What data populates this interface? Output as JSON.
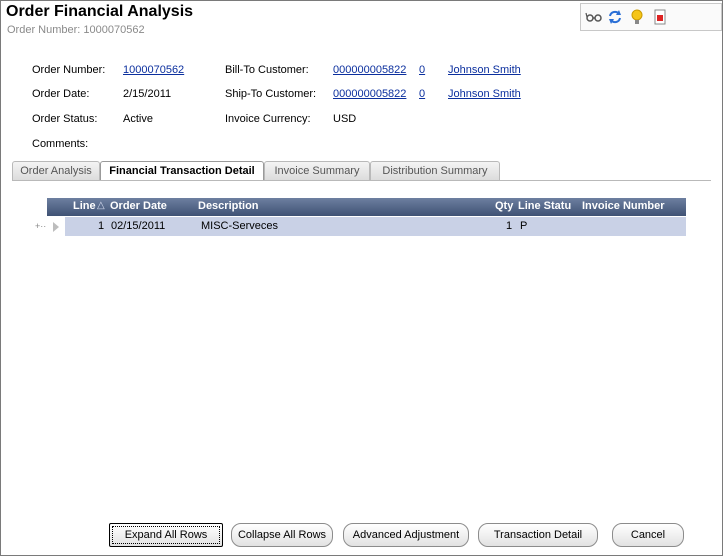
{
  "header": {
    "title": "Order Financial Analysis",
    "subtitle": "Order Number: 1000070562"
  },
  "toolbar_icons": [
    "glasses-icon",
    "refresh-icon",
    "lightbulb-icon",
    "pdf-icon"
  ],
  "fields": {
    "order_number_label": "Order Number:",
    "order_number_value": "1000070562",
    "order_date_label": "Order Date:",
    "order_date_value": "2/15/2011",
    "order_status_label": "Order Status:",
    "order_status_value": "Active",
    "comments_label": "Comments:",
    "bill_to_label": "Bill-To Customer:",
    "bill_to_id": "000000005822",
    "bill_to_sub": "0",
    "bill_to_name": "Johnson Smith",
    "ship_to_label": "Ship-To Customer:",
    "ship_to_id": "000000005822",
    "ship_to_sub": "0",
    "ship_to_name": "Johnson Smith",
    "invoice_currency_label": "Invoice Currency:",
    "invoice_currency_value": "USD"
  },
  "tabs": [
    {
      "label": "Order Analysis",
      "active": false
    },
    {
      "label": "Financial Transaction Detail",
      "active": true
    },
    {
      "label": "Invoice Summary",
      "active": false
    },
    {
      "label": "Distribution Summary",
      "active": false
    }
  ],
  "grid": {
    "columns": [
      "Line",
      "Order Date",
      "Description",
      "Qty",
      "Line Statu",
      "Invoice Number"
    ],
    "sort_indicator": "△",
    "row_control": "+··",
    "rows": [
      {
        "line": "1",
        "order_date": "02/15/2011",
        "description": "MISC-Serveces",
        "qty": "1",
        "line_status": "P",
        "invoice_number": ""
      }
    ]
  },
  "buttons": {
    "expand_all": "Expand All Rows",
    "collapse_all": "Collapse All Rows",
    "advanced_adjustment": "Advanced Adjustment",
    "transaction_detail": "Transaction Detail",
    "cancel": "Cancel"
  }
}
